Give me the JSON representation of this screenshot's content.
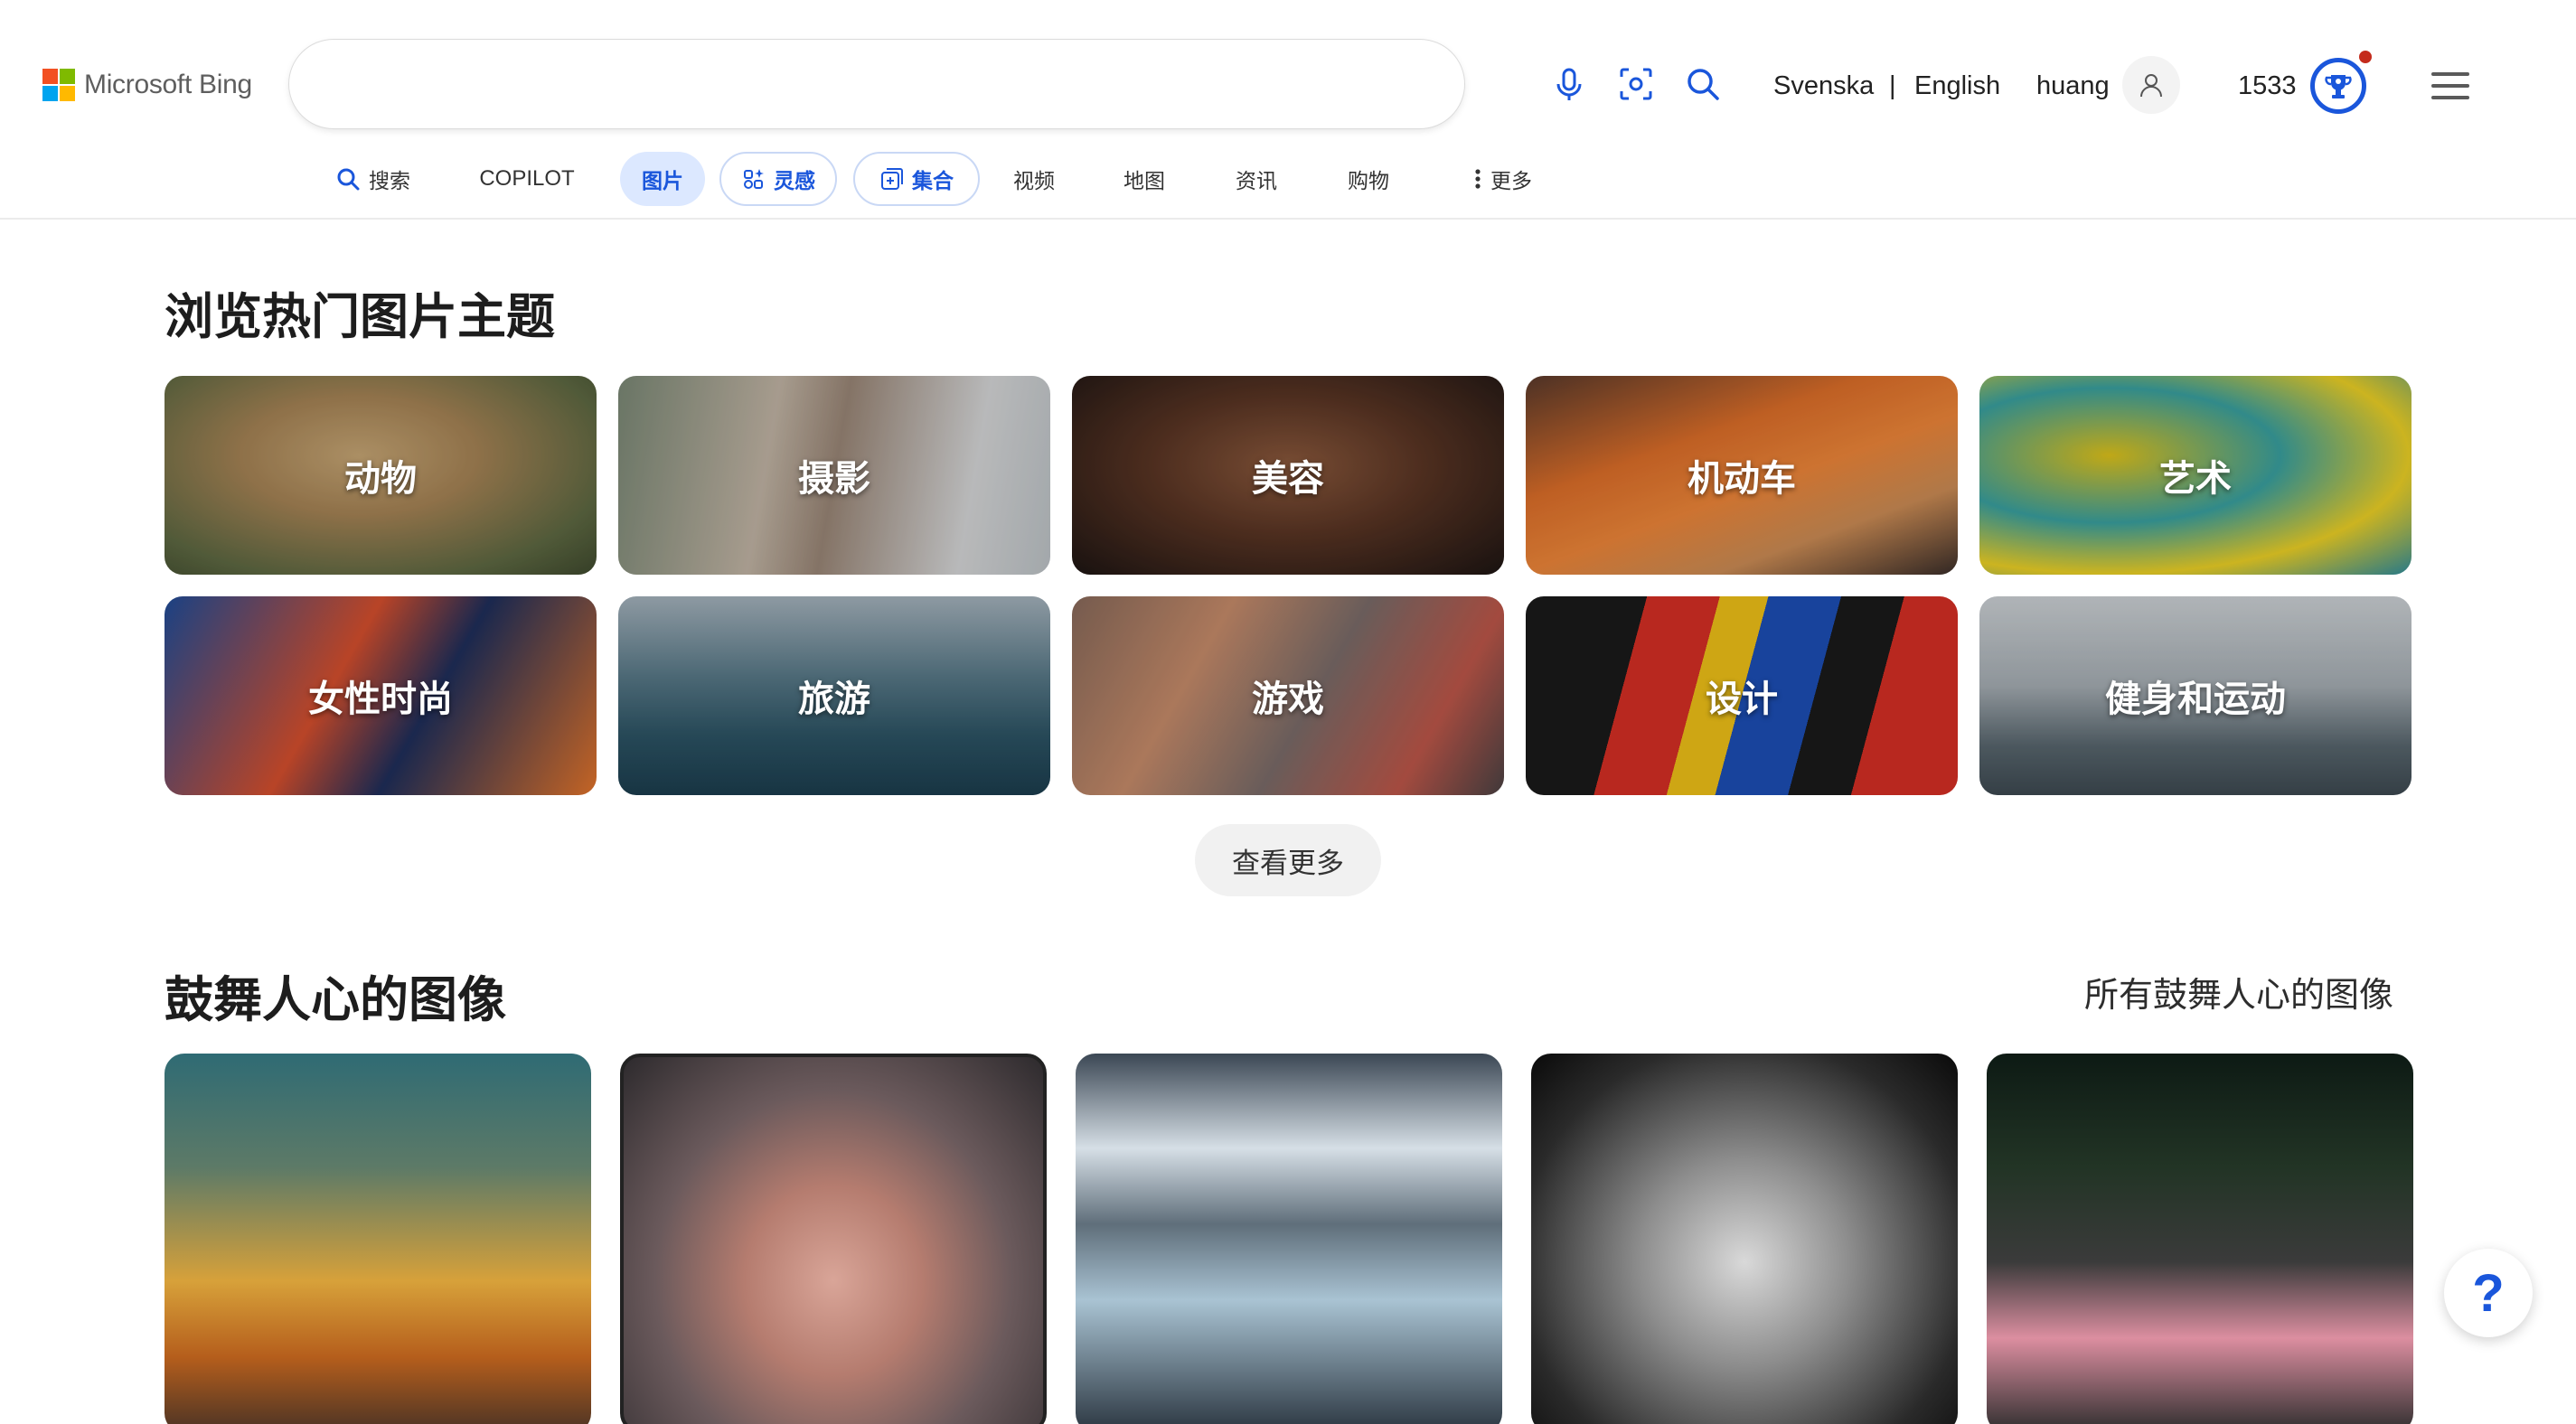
{
  "brand": {
    "logo_text": "Microsoft Bing"
  },
  "search": {
    "value": "",
    "placeholder": ""
  },
  "header": {
    "lang_primary": "Svenska",
    "lang_separator": "|",
    "lang_secondary": "English",
    "username": "huang",
    "points": "1533"
  },
  "nav": {
    "tabs": [
      {
        "label": "搜索"
      },
      {
        "label": "COPILOT"
      },
      {
        "label": "图片",
        "active": true
      },
      {
        "label": "灵感"
      },
      {
        "label": "集合"
      },
      {
        "label": "视频"
      },
      {
        "label": "地图"
      },
      {
        "label": "资讯"
      },
      {
        "label": "购物"
      },
      {
        "label": "更多"
      }
    ]
  },
  "topics": {
    "title": "浏览热门图片主题",
    "tiles": [
      {
        "label": "动物"
      },
      {
        "label": "摄影"
      },
      {
        "label": "美容"
      },
      {
        "label": "机动车"
      },
      {
        "label": "艺术"
      },
      {
        "label": "女性时尚"
      },
      {
        "label": "旅游"
      },
      {
        "label": "游戏"
      },
      {
        "label": "设计"
      },
      {
        "label": "健身和运动"
      }
    ],
    "see_more": "查看更多"
  },
  "inspiring": {
    "title": "鼓舞人心的图像",
    "see_all": "所有鼓舞人心的图像"
  },
  "help": {
    "label": "?"
  },
  "colors": {
    "accent": "#1a56db",
    "active_tab_bg": "#dce8ff",
    "notification": "#c42b1c"
  },
  "icons": [
    "search-icon",
    "microphone-icon",
    "visual-search-icon",
    "user-icon",
    "rewards-trophy-icon",
    "menu-icon",
    "inspiration-icon",
    "collections-icon",
    "more-dots-icon",
    "help-icon"
  ]
}
